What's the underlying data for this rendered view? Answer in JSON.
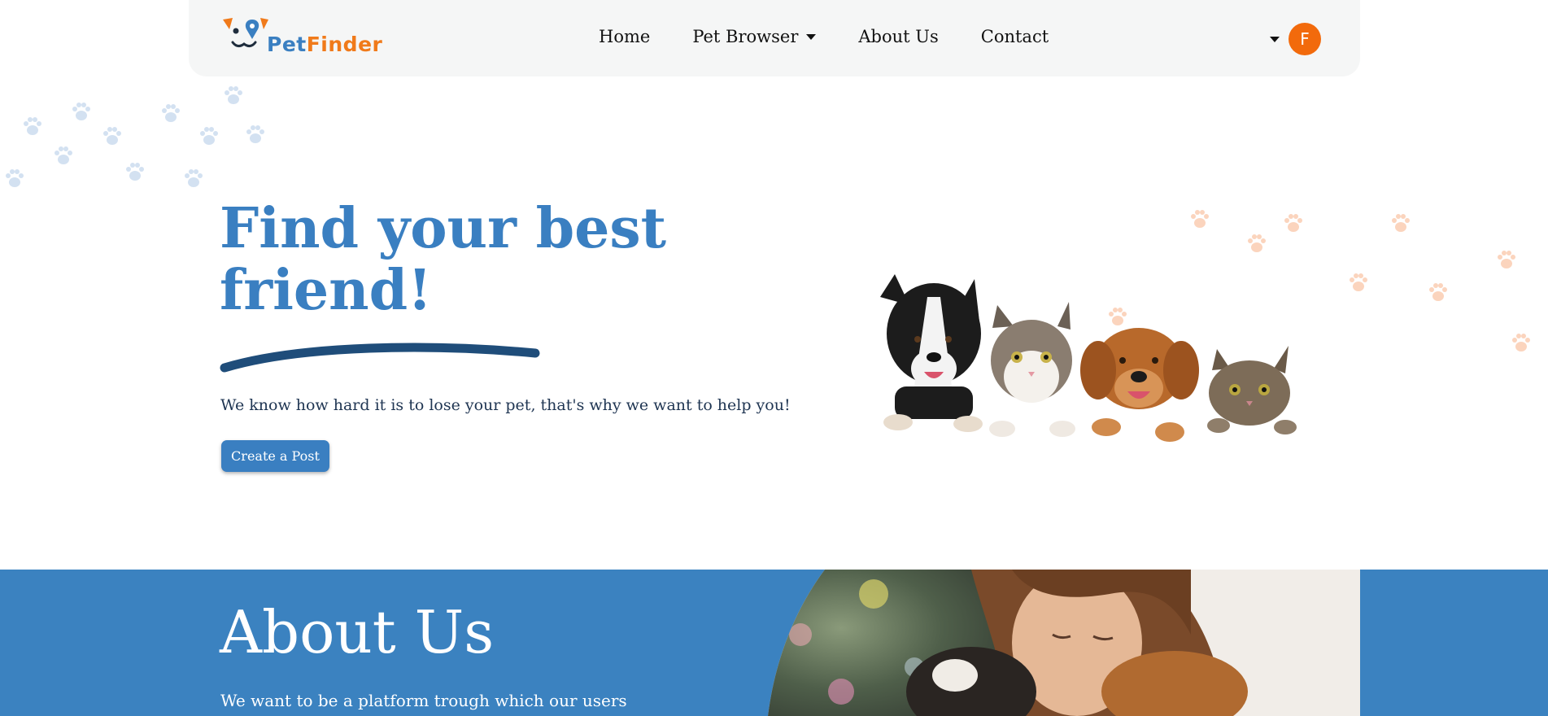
{
  "brand": {
    "name_part1": "Pet",
    "name_part2": "Finder"
  },
  "nav": {
    "items": [
      {
        "label": "Home"
      },
      {
        "label": "Pet Browser"
      },
      {
        "label": "About Us"
      },
      {
        "label": "Contact"
      }
    ],
    "user_initial": "F"
  },
  "hero": {
    "title": "Find your best friend!",
    "subtitle": "We know how hard it is to lose your pet, that's why we want to help you!",
    "cta_label": "Create a Post"
  },
  "about": {
    "title": "About Us",
    "text": "We want to be a platform trough which our users can find"
  },
  "colors": {
    "primary": "#3a7fc1",
    "accent": "#f07a1a",
    "about_bg": "#3b82c0",
    "avatar_bg": "#f26a0c",
    "navbar_bg": "#f5f6f6"
  }
}
